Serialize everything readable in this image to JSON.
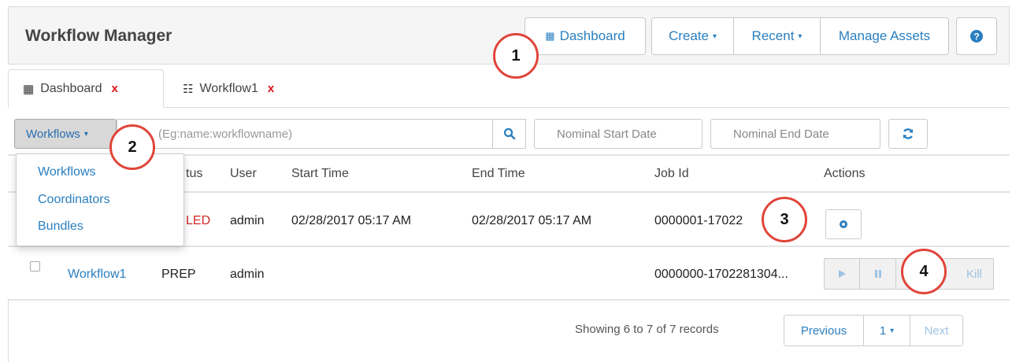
{
  "app": {
    "title": "Workflow Manager"
  },
  "header": {
    "dashboard_label": "Dashboard",
    "create_label": "Create",
    "recent_label": "Recent",
    "manage_assets_label": "Manage Assets",
    "help_icon": "question-circle-icon"
  },
  "tabs": [
    {
      "label": "Dashboard",
      "icon": "grid-icon",
      "close": "x"
    },
    {
      "label": "Workflow1",
      "icon": "sitemap-icon",
      "close": "x"
    }
  ],
  "filters": {
    "type_selected": "Workflows",
    "search_placeholder": "(Eg:name:workflowname)",
    "start_date_placeholder": "Nominal Start Date",
    "end_date_placeholder": "Nominal End Date"
  },
  "type_menu": [
    "Workflows",
    "Coordinators",
    "Bundles"
  ],
  "table": {
    "headers": [
      "tus",
      "User",
      "Start Time",
      "End Time",
      "Job Id",
      "Actions"
    ],
    "rows": [
      {
        "name": "",
        "status": "LED",
        "user": "admin",
        "start": "02/28/2017 05:17 AM",
        "end": "02/28/2017 05:17 AM",
        "job_id": "0000001-17022"
      },
      {
        "name": "Workflow1",
        "status": "PREP",
        "user": "admin",
        "start": "",
        "end": "",
        "job_id": "0000000-1702281304...",
        "kill_label": "Kill"
      }
    ]
  },
  "pagination": {
    "summary": "Showing 6 to 7 of 7 records",
    "previous": "Previous",
    "page": "1",
    "next": "Next"
  },
  "callouts": [
    "1",
    "2",
    "3",
    "4"
  ],
  "colors": {
    "link": "#2a7fc0",
    "close": "#e0151b",
    "callout_border": "#e0453a",
    "failed": "#d02a2a"
  }
}
